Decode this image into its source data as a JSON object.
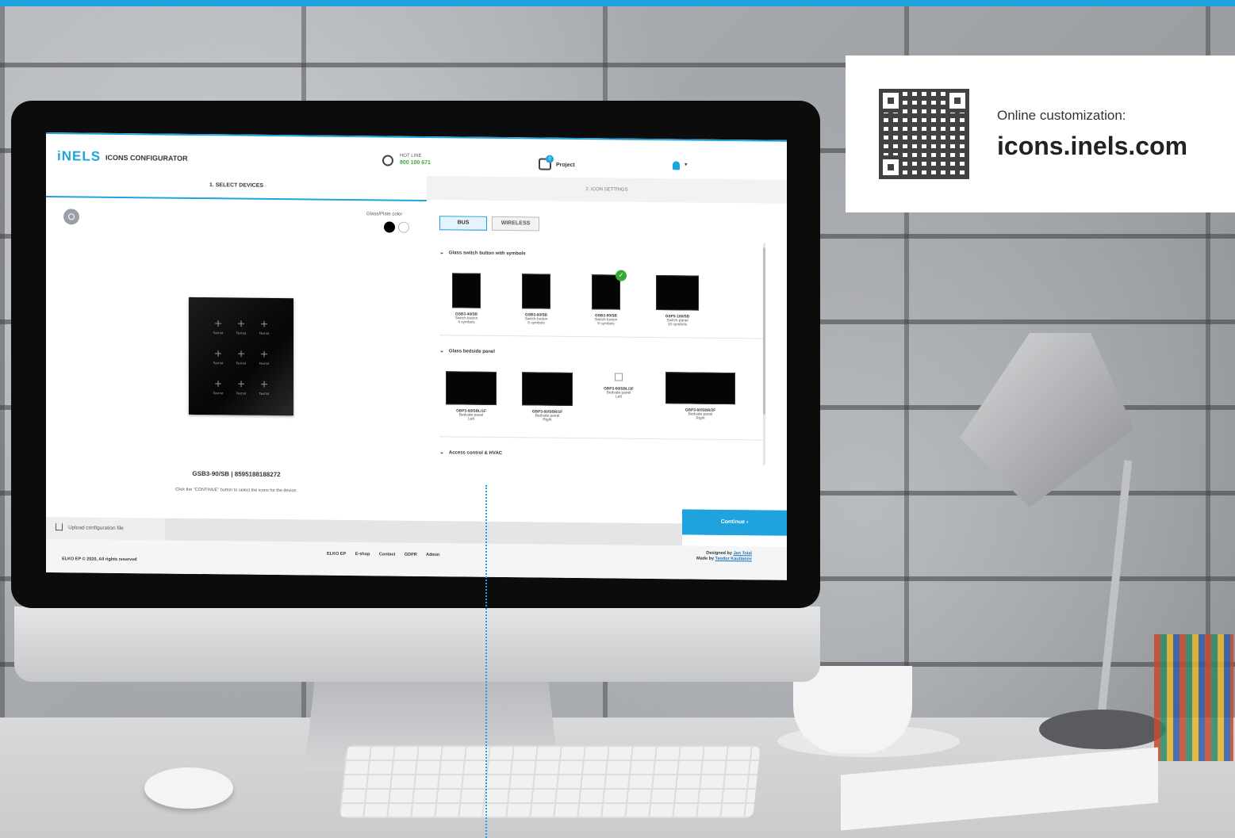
{
  "promo": {
    "caption": "Online customization:",
    "url": "icons.inels.com"
  },
  "header": {
    "logo": "iNELS",
    "app_name": "ICONS CONFIGURATOR",
    "hotline_label": "HOT LINE",
    "hotline_number": "800 100 671",
    "project_badge": "0",
    "project_label": "Project",
    "user_caret": "▾"
  },
  "steps": {
    "step1": "1. SELECT DEVICES",
    "step2": "2. ICON SETTINGS"
  },
  "left_panel": {
    "glass_color_label": "Glass/Plate color",
    "preview_cell_text": "Text txt",
    "device_id": "GSB3-90/SB | 8595188188272",
    "hint": "Click the \"CONTINUE\" button to select the icons for the device."
  },
  "right_panel": {
    "tabs": [
      "BUS",
      "WIRELESS"
    ],
    "sections": [
      {
        "title": "Glass switch button with symbols",
        "devices": [
          {
            "code": "GSB3-40/SB",
            "type": "Switch button",
            "detail": "4 symbols"
          },
          {
            "code": "GSB3-60/SB",
            "type": "Switch button",
            "detail": "6 symbols"
          },
          {
            "code": "GSB3-90/SB",
            "type": "Switch button",
            "detail": "9 symbols",
            "selected": true
          },
          {
            "code": "GSP3-100/SB",
            "type": "Switch panel",
            "detail": "10 symbols"
          }
        ]
      },
      {
        "title": "Glass bedside panel",
        "devices": [
          {
            "code": "GBP3-60/SBL/1F",
            "type": "Bedside panel",
            "detail": "Left"
          },
          {
            "code": "GBP3-60/SBR/1F",
            "type": "Bedside panel",
            "detail": "Right"
          },
          {
            "code": "GBP3-60/SBL/2F",
            "type": "Bedside panel",
            "detail": "Left"
          },
          {
            "code": "GBP3-60/SBR/2F",
            "type": "Bedside panel",
            "detail": "Right"
          }
        ]
      },
      {
        "title": "Access control & HVAC",
        "devices": []
      }
    ]
  },
  "actions": {
    "continue": "Continue  ›",
    "upload": "Upload configuration file"
  },
  "footer": {
    "copyright": "ELKO EP © 2020, All rights reserved",
    "links": [
      "ELKO EP",
      "E-shop",
      "Contact",
      "GDPR",
      "Admin"
    ],
    "designed_by_prefix": "Designed by",
    "designer": "Jan Tolal",
    "made_by_prefix": "Made by",
    "developer": "Teodor Kautianov"
  },
  "colors": {
    "accent": "#1fa3de",
    "success": "#3aa836"
  },
  "icons": [
    "camera-icon",
    "phone-icon",
    "project-icon",
    "user-icon",
    "upload-icon",
    "chevron-down-icon",
    "check-icon",
    "qr-code"
  ]
}
